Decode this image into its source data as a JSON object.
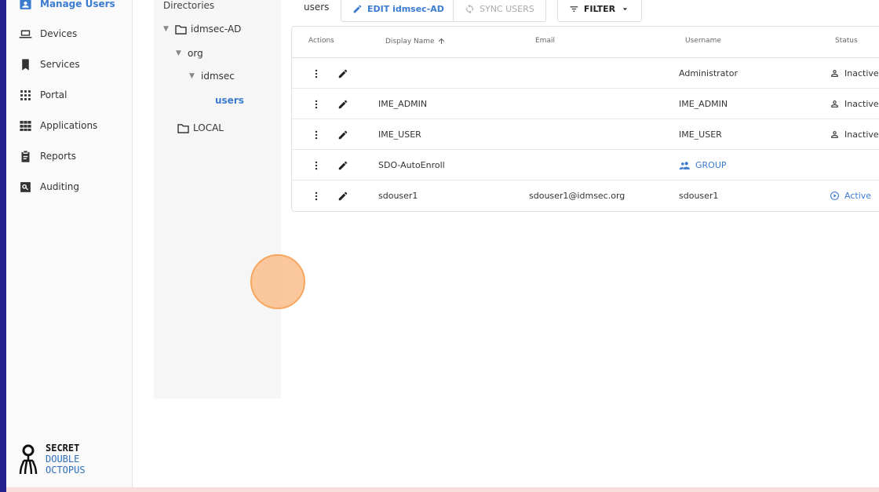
{
  "sidebar": {
    "items": [
      {
        "label": "Manage Users",
        "icon": "user-badge-icon",
        "active": true
      },
      {
        "label": "Devices",
        "icon": "laptop-icon"
      },
      {
        "label": "Services",
        "icon": "bookmark-icon"
      },
      {
        "label": "Portal",
        "icon": "grid-dots-icon"
      },
      {
        "label": "Applications",
        "icon": "apps-grid-icon"
      },
      {
        "label": "Reports",
        "icon": "clipboard-icon"
      },
      {
        "label": "Auditing",
        "icon": "search-box-icon"
      }
    ],
    "logo": {
      "line1": "SECRET",
      "line2": "DOUBLE",
      "line3": "OCTOPUS"
    }
  },
  "directories": {
    "title": "Directories",
    "tree": [
      {
        "label": "idmsec-AD",
        "level": 0,
        "folder": true,
        "expanded": true
      },
      {
        "label": "org",
        "level": 1,
        "folder": false,
        "expanded": true
      },
      {
        "label": "idmsec",
        "level": 2,
        "folder": false,
        "expanded": true
      },
      {
        "label": "users",
        "level": 3,
        "folder": false,
        "selected": true
      },
      {
        "label": "LOCAL",
        "level": 0,
        "folder": true
      }
    ]
  },
  "toolbar": {
    "current_tab": "users",
    "edit_label": "EDIT idmsec-AD",
    "sync_label": "SYNC USERS",
    "filter_label": "FILTER"
  },
  "table": {
    "headers": {
      "actions": "Actions",
      "display_name": "Display Name",
      "email": "Email",
      "username": "Username",
      "status": "Status"
    },
    "rows": [
      {
        "display_name": "",
        "email": "",
        "username": "Administrator",
        "status": "Inactive"
      },
      {
        "display_name": "IME_ADMIN",
        "email": "",
        "username": "IME_ADMIN",
        "status": "Inactive"
      },
      {
        "display_name": "IME_USER",
        "email": "",
        "username": "IME_USER",
        "status": "Inactive"
      },
      {
        "display_name": "SDO-AutoEnroll",
        "email": "",
        "username": "GROUP",
        "status": ""
      },
      {
        "display_name": "sdouser1",
        "email": "sdouser1@idmsec.org",
        "username": "sdouser1",
        "status": "Active"
      }
    ]
  },
  "colors": {
    "accent": "#3b7bd0",
    "left_bar": "#23208f",
    "cursor_highlight": "#f7a65e"
  }
}
